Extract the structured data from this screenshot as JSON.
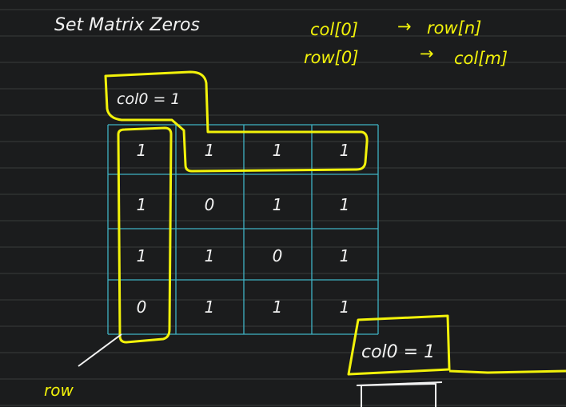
{
  "board": {
    "background_color": "#1b1c1d",
    "ruling_color": "#3a3b3c",
    "ink_white": "#f2f2f2",
    "ink_yellow": "#f2f20a",
    "grid_color": "#3fb2c4"
  },
  "title": "Set Matrix Zeros",
  "notes": {
    "line1_left": "col[0]",
    "line1_arrow": "→",
    "line1_right": "row[n]",
    "line2_left": "row[0]",
    "line2_arrow": "→",
    "line2_right": "col[m]"
  },
  "labels": {
    "col0_top": "col0 = 1",
    "col0_bottom": "col0 = 1",
    "row": "row"
  },
  "matrix": [
    [
      "1",
      "1",
      "1",
      "1"
    ],
    [
      "1",
      "0",
      "1",
      "1"
    ],
    [
      "1",
      "1",
      "0",
      "1"
    ],
    [
      "0",
      "1",
      "1",
      "1"
    ]
  ]
}
